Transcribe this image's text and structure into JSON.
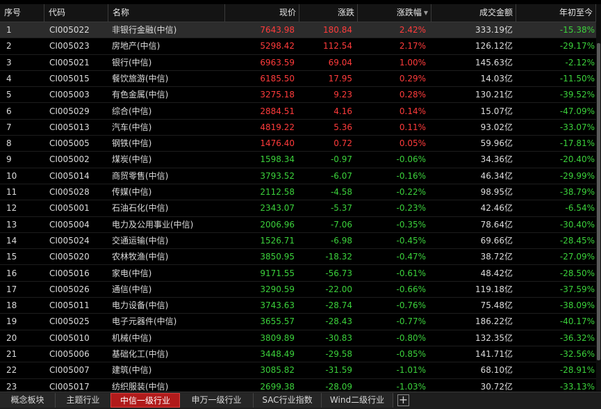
{
  "columns": [
    "序号",
    "代码",
    "名称",
    "现价",
    "涨跌",
    "涨跌幅",
    "成交金额",
    "年初至今"
  ],
  "selected_row": 0,
  "colors": {
    "up": "#ff3b3b",
    "down": "#3bd13b",
    "active_tab": "#b11b1b"
  },
  "rows": [
    [
      "1",
      "CI005022",
      "非银行金融(中信)",
      "7643.98",
      "180.84",
      "2.42%",
      "333.19亿",
      "-15.38%"
    ],
    [
      "2",
      "CI005023",
      "房地产(中信)",
      "5298.42",
      "112.54",
      "2.17%",
      "126.12亿",
      "-29.17%"
    ],
    [
      "3",
      "CI005021",
      "银行(中信)",
      "6963.59",
      "69.04",
      "1.00%",
      "145.63亿",
      "-2.12%"
    ],
    [
      "4",
      "CI005015",
      "餐饮旅游(中信)",
      "6185.50",
      "17.95",
      "0.29%",
      "14.03亿",
      "-11.50%"
    ],
    [
      "5",
      "CI005003",
      "有色金属(中信)",
      "3275.18",
      "9.23",
      "0.28%",
      "130.21亿",
      "-39.52%"
    ],
    [
      "6",
      "CI005029",
      "综合(中信)",
      "2884.51",
      "4.16",
      "0.14%",
      "15.07亿",
      "-47.09%"
    ],
    [
      "7",
      "CI005013",
      "汽车(中信)",
      "4819.22",
      "5.36",
      "0.11%",
      "93.02亿",
      "-33.07%"
    ],
    [
      "8",
      "CI005005",
      "钢铁(中信)",
      "1476.40",
      "0.72",
      "0.05%",
      "59.96亿",
      "-17.81%"
    ],
    [
      "9",
      "CI005002",
      "煤炭(中信)",
      "1598.34",
      "-0.97",
      "-0.06%",
      "34.36亿",
      "-20.40%"
    ],
    [
      "10",
      "CI005014",
      "商贸零售(中信)",
      "3793.52",
      "-6.07",
      "-0.16%",
      "46.34亿",
      "-29.99%"
    ],
    [
      "11",
      "CI005028",
      "传媒(中信)",
      "2112.58",
      "-4.58",
      "-0.22%",
      "98.95亿",
      "-38.79%"
    ],
    [
      "12",
      "CI005001",
      "石油石化(中信)",
      "2343.07",
      "-5.37",
      "-0.23%",
      "42.46亿",
      "-6.54%"
    ],
    [
      "13",
      "CI005004",
      "电力及公用事业(中信)",
      "2006.96",
      "-7.06",
      "-0.35%",
      "78.64亿",
      "-30.40%"
    ],
    [
      "14",
      "CI005024",
      "交通运输(中信)",
      "1526.71",
      "-6.98",
      "-0.45%",
      "69.66亿",
      "-28.45%"
    ],
    [
      "15",
      "CI005020",
      "农林牧渔(中信)",
      "3850.95",
      "-18.32",
      "-0.47%",
      "38.72亿",
      "-27.09%"
    ],
    [
      "16",
      "CI005016",
      "家电(中信)",
      "9171.55",
      "-56.73",
      "-0.61%",
      "48.42亿",
      "-28.50%"
    ],
    [
      "17",
      "CI005026",
      "通信(中信)",
      "3290.59",
      "-22.00",
      "-0.66%",
      "119.18亿",
      "-37.59%"
    ],
    [
      "18",
      "CI005011",
      "电力设备(中信)",
      "3743.63",
      "-28.74",
      "-0.76%",
      "75.48亿",
      "-38.09%"
    ],
    [
      "19",
      "CI005025",
      "电子元器件(中信)",
      "3655.57",
      "-28.43",
      "-0.77%",
      "186.22亿",
      "-40.17%"
    ],
    [
      "20",
      "CI005010",
      "机械(中信)",
      "3809.89",
      "-30.83",
      "-0.80%",
      "132.35亿",
      "-36.32%"
    ],
    [
      "21",
      "CI005006",
      "基础化工(中信)",
      "3448.49",
      "-29.58",
      "-0.85%",
      "141.71亿",
      "-32.56%"
    ],
    [
      "22",
      "CI005007",
      "建筑(中信)",
      "3085.82",
      "-31.59",
      "-1.01%",
      "68.10亿",
      "-28.91%"
    ],
    [
      "23",
      "CI005017",
      "纺织服装(中信)",
      "2699.38",
      "-28.09",
      "-1.03%",
      "30.72亿",
      "-33.13%"
    ]
  ],
  "tabs": [
    "概念板块",
    "主题行业",
    "中信一级行业",
    "申万一级行业",
    "SAC行业指数",
    "Wind二级行业"
  ],
  "active_tab": 2,
  "add_tab_label": "+"
}
